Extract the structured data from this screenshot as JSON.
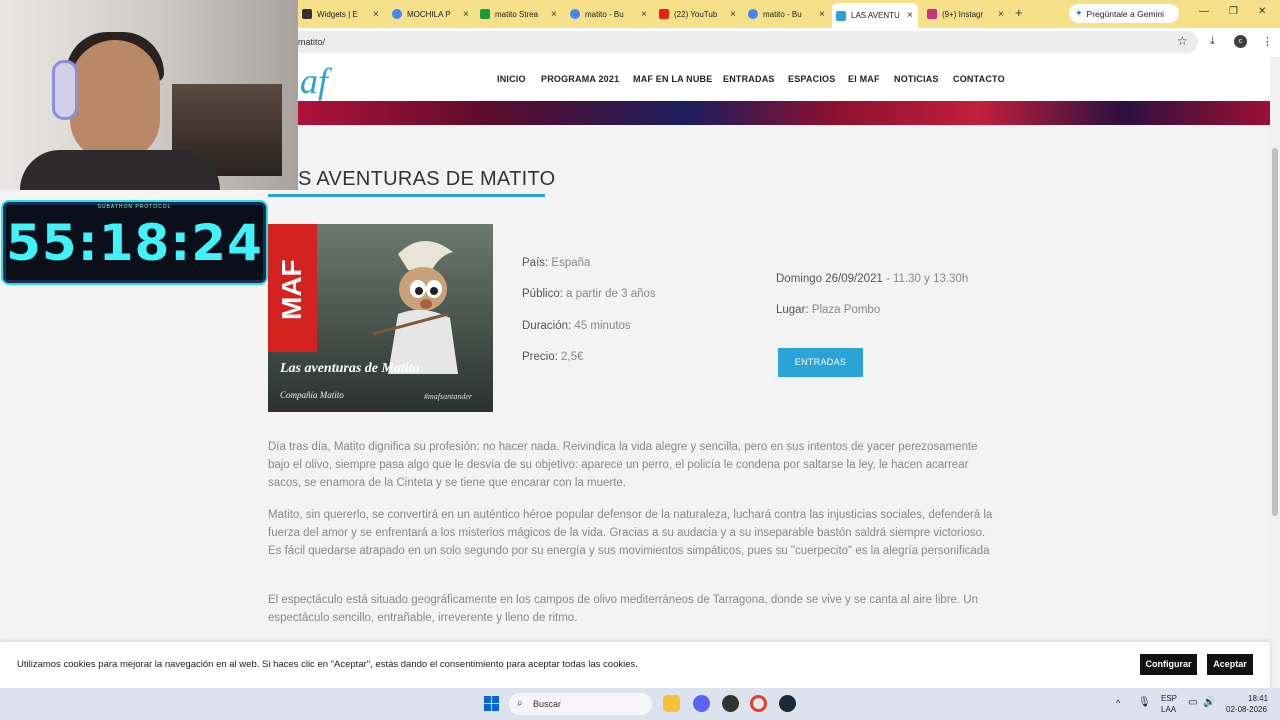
{
  "browser": {
    "tabs": [
      {
        "title": "Widgets | E",
        "color": "#333333"
      },
      {
        "title": "MOCHILA P",
        "color": "#4285f4"
      },
      {
        "title": "matito Strea",
        "color": "#1a9b3a"
      },
      {
        "title": "matito - Bu",
        "color": "#4285f4"
      },
      {
        "title": "(22) YouTub",
        "color": "#e62117"
      },
      {
        "title": "matito - Bu",
        "color": "#4285f4"
      },
      {
        "title": "LAS AVENTU",
        "color": "#2aa3d6"
      },
      {
        "title": "(9+) Instagr",
        "color": "#c13584"
      }
    ],
    "gemini_label": "Pregúntale a Gemini",
    "url": "matito/",
    "profile_initial": "c"
  },
  "site": {
    "logo": "af",
    "nav": [
      "INICIO",
      "PROGRAMA 2021",
      "MAF EN LA NUBE",
      "ENTRADAS",
      "ESPACIOS",
      "El MAF",
      "NOTICIAS",
      "CONTACTO"
    ],
    "page_title": "S AVENTURAS DE MATITO",
    "poster": {
      "brand": "MAF",
      "title": "Las aventuras de Matito",
      "company": "Compañía Matito",
      "hashtag": "#mafsantander"
    },
    "details": {
      "pais_label": "País:",
      "pais_value": "España",
      "publico_label": "Público:",
      "publico_value": "a partir de 3 años",
      "duracion_label": "Duración:",
      "duracion_value": "45 minutos",
      "precio_label": "Precio:",
      "precio_value": "2,5€",
      "fecha_label": "Domingo 26/09/2021",
      "fecha_value": "- 11.30 y 13.30h",
      "lugar_label": "Lugar:",
      "lugar_value": "Plaza Pombo"
    },
    "entradas_button": "ENTRADAS",
    "paragraphs": [
      "Día tras día, Matito dignifica su profesión: no hacer nada. Reivindica la vida alegre y sencilla, pero en sus intentos de yacer perezosamente bajo el olivo, siempre pasa algo que le desvía de su objetivo: aparece un perro, el policía le condena por saltarse la ley, le hacen acarrear sacos, se enamora de la Cinteta y se tiene que encarar con la muerte.",
      "Matito, sin quererlo, se convertirá en un auténtico héroe popular defensor de la naturaleza, luchará contra las injusticias sociales, defenderá la fuerza del amor y se enfrentará a los misterios mágicos de la vida. Gracias a su audacia y a su inseparable bastón saldrá siempre victorioso. Es fácil quedarse atrapado en un solo segundo por su energía y sus movimientos simpáticos, pues su \"cuerpecito\" es la alegría personificada",
      "El espectáculo está situado geográficamente en los campos de olivo mediterráneos de Tarragona, donde se vive y se canta al aire libre. Un espectáculo sencillo, entrañable, irreverente y lleno de ritmo."
    ]
  },
  "cookie": {
    "message": "Utilizamos cookies para mejorar la navegación en al web. Si haces clic en \"Aceptar\", estás dando el consentimiento para aceptar todas las cookies.",
    "configurar": "Configurar",
    "aceptar": "Aceptar"
  },
  "taskbar": {
    "search_placeholder": "Buscar",
    "lang_top": "ESP",
    "lang_bottom": "LAA",
    "time": "18:41",
    "date": "02-08-2026"
  },
  "overlay": {
    "timer_label": "SUBATHON PROTOCOL",
    "timer_value": "55:18:24"
  }
}
